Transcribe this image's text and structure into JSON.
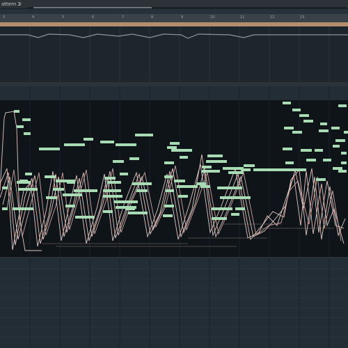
{
  "tab": {
    "title": "attern 2",
    "close_glyph": "×"
  },
  "ruler": {
    "ticks": [
      "3",
      "4",
      "5",
      "6",
      "7",
      "8",
      "9",
      "10",
      "11",
      "12",
      "13"
    ]
  },
  "colors": {
    "background": "#27313a",
    "lane": "#0e1418",
    "note": "#a9dcb5",
    "curve": "#e6c7c2",
    "accent": "#b68d6a"
  },
  "zoom_scroll": {
    "thumb_fraction": 0.37
  }
}
